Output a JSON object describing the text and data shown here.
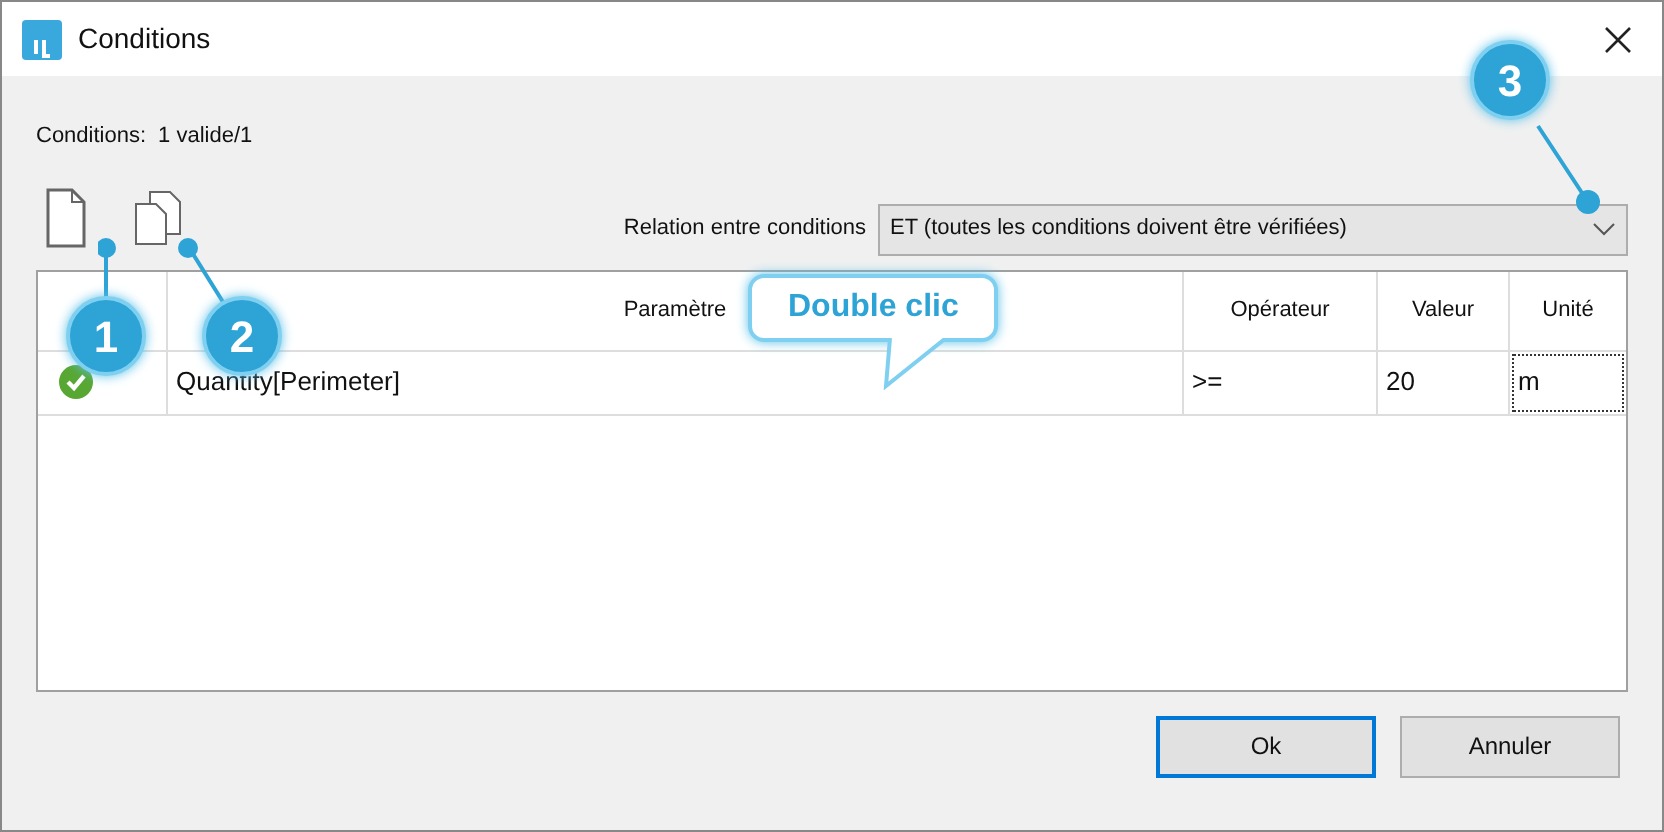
{
  "window": {
    "title": "Conditions"
  },
  "summary": {
    "label": "Conditions:",
    "value": "1 valide/1"
  },
  "relation": {
    "label": "Relation entre conditions",
    "value": "ET (toutes les conditions doivent être vérifiées)"
  },
  "table": {
    "columns": [
      "Paramètre",
      "Opérateur",
      "Valeur",
      "Unité"
    ],
    "rows": [
      {
        "valid": true,
        "parameter": "Quantity[Perimeter]",
        "operator": ">=",
        "value": "20",
        "unit": "m"
      }
    ]
  },
  "callouts": [
    {
      "number": "1"
    },
    {
      "number": "2"
    },
    {
      "number": "3"
    }
  ],
  "tooltip": "Double clic",
  "buttons": [
    {
      "label": "Ok",
      "default": true
    },
    {
      "label": "Annuler",
      "default": false
    }
  ]
}
